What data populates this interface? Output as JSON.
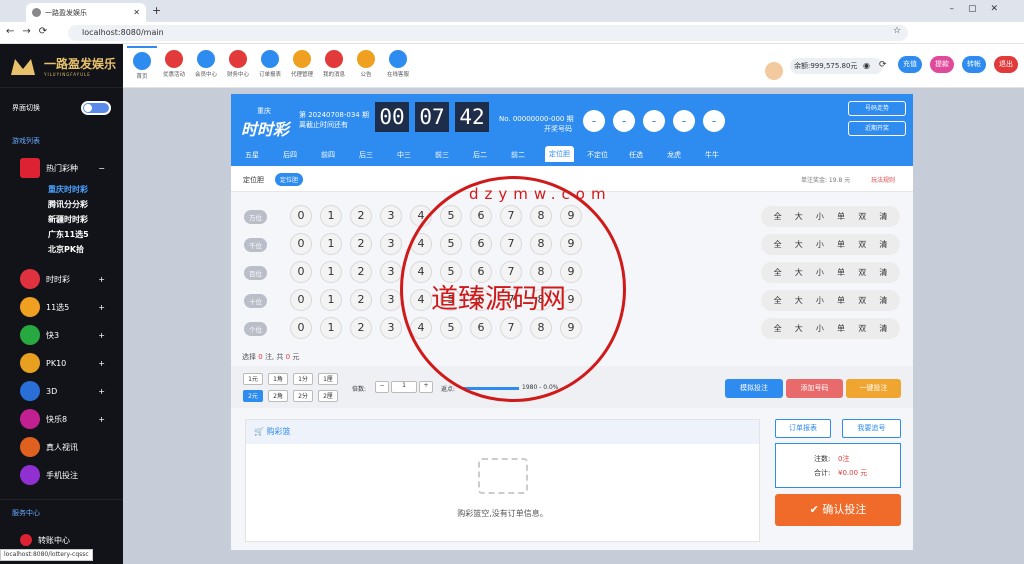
{
  "browser": {
    "tab_title": "一路盈发娱乐",
    "url": "localhost:8080/main",
    "status_url": "localhost:8080/lottery-cqssc"
  },
  "brand": {
    "name": "一路盈发娱乐",
    "sub": "YILUYINGFAYULE"
  },
  "sidebar": {
    "toggle_label": "界面切换",
    "section_games": "游戏列表",
    "hot": "热门彩种",
    "hot_items": [
      "重庆时时彩",
      "腾讯分分彩",
      "新疆时时彩",
      "广东11选5",
      "北京PK拾"
    ],
    "groups": [
      "时时彩",
      "11选5",
      "快3",
      "PK10",
      "3D",
      "快乐8",
      "真人视讯",
      "手机投注"
    ],
    "section_service": "服务中心",
    "transfer": "转账中心"
  },
  "nav": [
    "首页",
    "优惠活动",
    "会员中心",
    "财务中心",
    "订单报表",
    "代理管理",
    "我的消息",
    "公告",
    "在线客服"
  ],
  "top": {
    "balance": "余额:999,575.80元",
    "btns": [
      "充值",
      "提款",
      "转帐",
      "退出"
    ]
  },
  "lottery": {
    "logo": "时时彩",
    "logo_sub": "重庆",
    "period": "第 20240708-034 期",
    "deadline": "离截止时间还有",
    "clock": [
      "00",
      "07",
      "42"
    ],
    "last": "No. 00000000-000 期",
    "open": "开奖号码",
    "result": [
      "-",
      "-",
      "-",
      "-",
      "-"
    ],
    "trend_btn": "号码走势",
    "recent_btn": "近期开奖"
  },
  "tabs": [
    "五星",
    "后四",
    "前四",
    "后三",
    "中三",
    "前三",
    "后二",
    "前二",
    "定位胆",
    "不定位",
    "任选",
    "龙虎",
    "牛牛"
  ],
  "play": {
    "label": "定位胆",
    "chip": "定位胆",
    "bonus": "单注奖金: 19.8 元",
    "rules": "玩法规则"
  },
  "positions": [
    "万位",
    "千位",
    "百位",
    "十位",
    "个位"
  ],
  "digits": [
    "0",
    "1",
    "2",
    "3",
    "4",
    "5",
    "6",
    "7",
    "8",
    "9"
  ],
  "quick": [
    "全",
    "大",
    "小",
    "单",
    "双",
    "清"
  ],
  "selection": {
    "prefix": "选择",
    "count": "0",
    "mid": "注, 共",
    "amount": "0",
    "suffix": "元"
  },
  "units": [
    "1元",
    "1角",
    "1分",
    "1厘",
    "2元",
    "2角",
    "2分",
    "2厘"
  ],
  "multiple": {
    "label": "倍数:",
    "value": "1"
  },
  "rebate": {
    "label": "返点:",
    "value": "1980 - 0.0%"
  },
  "actions": [
    "模拟投注",
    "添加号码",
    "一键投注"
  ],
  "cart": {
    "title": "购彩篮",
    "empty": "购彩篮空,没有订单信息。"
  },
  "order": {
    "report": "订单报表",
    "chase": "我要追号",
    "count_label": "注数:",
    "count": "0注",
    "total_label": "合计:",
    "total": "¥0.00 元",
    "confirm": "确认投注"
  },
  "watermark": {
    "main": "道臻源码网",
    "domain": "dzymw.com"
  }
}
